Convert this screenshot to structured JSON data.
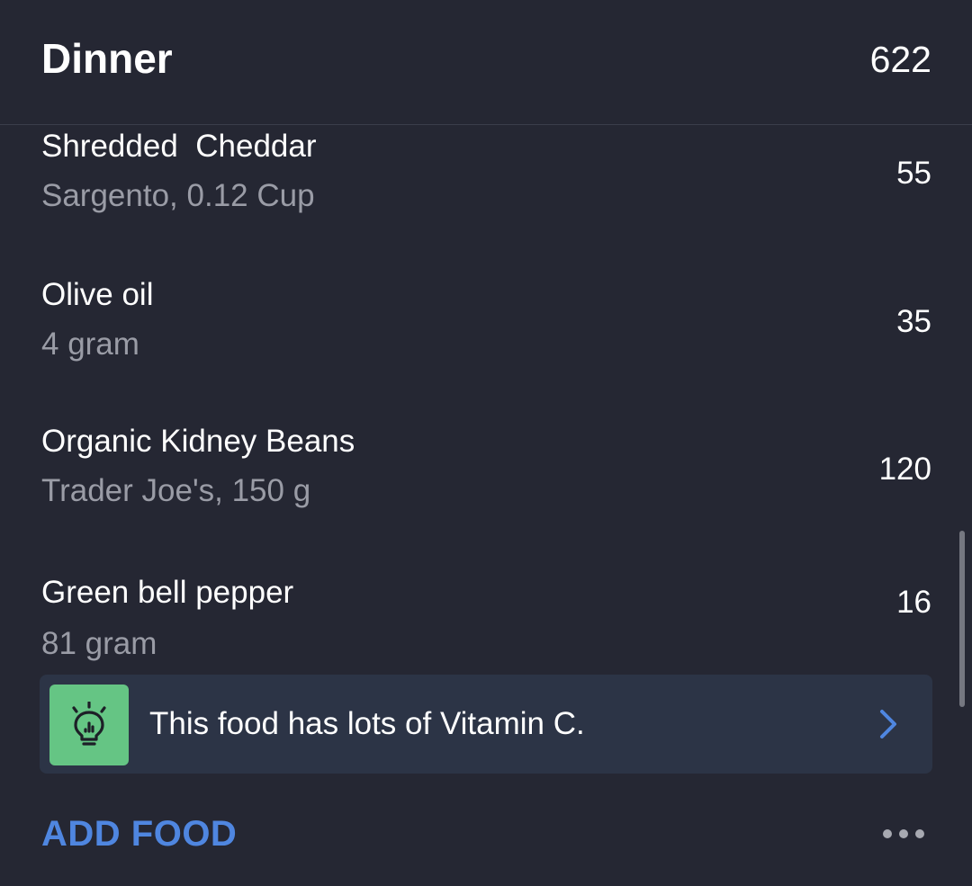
{
  "meal": {
    "title": "Dinner",
    "total_calories": "622"
  },
  "food_items": [
    {
      "name": "Shredded  Cheddar",
      "detail": "Sargento, 0.12 Cup",
      "calories": "55"
    },
    {
      "name": "Olive oil",
      "detail": "4 gram",
      "calories": "35"
    },
    {
      "name": "Organic Kidney Beans",
      "detail": "Trader Joe's, 150 g",
      "calories": "120"
    },
    {
      "name": "Green bell pepper",
      "detail": "81 gram",
      "calories": "16"
    }
  ],
  "tip": {
    "text": "This food has lots of Vitamin C.",
    "icon": "lightbulb-icon",
    "chevron_icon": "chevron-right-icon"
  },
  "actions": {
    "add_food_label": "ADD FOOD",
    "more_icon": "more-horizontal-icon"
  },
  "colors": {
    "background": "#252733",
    "accent_blue": "#4f86e0",
    "tip_green": "#65c584",
    "tip_background": "#2c3446",
    "secondary_text": "#9a9ca6"
  }
}
